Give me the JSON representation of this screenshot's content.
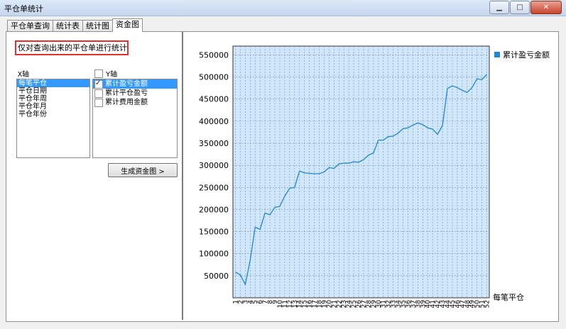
{
  "window": {
    "title": "平仓单统计"
  },
  "tabs": [
    {
      "label": "平仓单查询"
    },
    {
      "label": "统计表"
    },
    {
      "label": "统计图"
    },
    {
      "label": "资金图"
    }
  ],
  "left": {
    "note": "仅对查询出来的平仓单进行统计",
    "x_label": "X轴",
    "y_label": "Y轴",
    "x_items": [
      "每笔平仓",
      "平仓日期",
      "平仓年周",
      "平仓年月",
      "平仓年份"
    ],
    "y_items": [
      {
        "label": "累计盈亏金额",
        "checked": true
      },
      {
        "label": "累计平仓盈亏",
        "checked": false
      },
      {
        "label": "累计费用金额",
        "checked": false
      }
    ],
    "generate_button": "生成资金图 >"
  },
  "chart_data": {
    "type": "line",
    "xlabel": "每笔平仓",
    "ylabel": "",
    "ylim": [
      0,
      570000
    ],
    "ytick_values": [
      50000,
      100000,
      150000,
      200000,
      250000,
      300000,
      350000,
      400000,
      450000,
      500000,
      550000
    ],
    "yticks": [
      "50000",
      "100000",
      "150000",
      "200000",
      "250000",
      "300000",
      "350000",
      "400000",
      "450000",
      "500000",
      "550000"
    ],
    "x": [
      1,
      2,
      3,
      4,
      5,
      6,
      7,
      8,
      9,
      10,
      11,
      12,
      13,
      14,
      15,
      16,
      17,
      18,
      19,
      20,
      21,
      22,
      23,
      24,
      25,
      26,
      27,
      28,
      29,
      30,
      31,
      32,
      33,
      34,
      35,
      36,
      37,
      38,
      39,
      40,
      41,
      42,
      43,
      44,
      45,
      46,
      47,
      48,
      49,
      50,
      51,
      52
    ],
    "grid": true,
    "legend": "top-right",
    "color": "#1e87d6",
    "series": [
      {
        "name": "累计盈亏金额",
        "values": [
          58000,
          52000,
          30000,
          85000,
          160000,
          155000,
          192000,
          188000,
          205000,
          207000,
          230000,
          248000,
          250000,
          287000,
          283000,
          282000,
          281000,
          281000,
          285000,
          295000,
          293000,
          303000,
          305000,
          305000,
          308000,
          307000,
          313000,
          323000,
          328000,
          357000,
          357000,
          365000,
          366000,
          373000,
          383000,
          385000,
          391000,
          396000,
          392000,
          385000,
          382000,
          370000,
          390000,
          474000,
          480000,
          476000,
          470000,
          465000,
          476000,
          496000,
          494000,
          506000
        ]
      }
    ]
  }
}
